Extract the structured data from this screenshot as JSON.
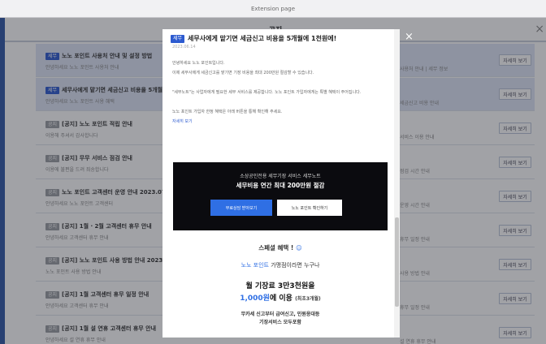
{
  "window": {
    "title": "Extension page"
  },
  "page": {
    "title": "공지",
    "close": "×"
  },
  "rows": [
    {
      "badge": "세무",
      "title": "노노 포인트 사용처 안내 및 설정 방법",
      "snip": "안녕하세요 노노 포인트 사용처 안내",
      "snip_r": "사용처 안내 | 세무 정보",
      "more": "자세히 보기"
    },
    {
      "badge": "세무",
      "title": "세무사에게 맡기면 세금신고 비용을 5개월에 1천원에!",
      "snip": "안녕하세요 노노 포인트 사용 혜택",
      "snip_r": "세금신고 비용 안내",
      "more": "자세히 보기"
    },
    {
      "badge": "공지",
      "title": "[공지] 노노 포인트 적립 안내",
      "snip": "이용해 주셔서 감사합니다",
      "snip_r": "서비스 이용 안내",
      "more": "자세히 보기"
    },
    {
      "badge": "공지",
      "title": "[공지] 무무 서비스 점검 안내",
      "snip": "이용에 불편을 드려 죄송합니다",
      "snip_r": "점검 시간 안내",
      "more": "자세히 보기"
    },
    {
      "badge": "공지",
      "title": "노노 포인트 고객센터 운영 안내 2023.07.31",
      "snip": "안녕하세요 노노 포인트 고객센터",
      "snip_r": "운영 시간 안내",
      "more": "자세히 보기"
    },
    {
      "badge": "공지",
      "title": "[공지] 1월 · 2월 고객센터 휴무 안내",
      "snip": "안녕하세요 고객센터 휴무 안내",
      "snip_r": "휴무 일정 안내",
      "more": "자세히 보기"
    },
    {
      "badge": "공지",
      "title": "[공지] 노노 포인트 사용 방법 안내 2023.02",
      "snip": "노노 포인트 사용 방법 안내",
      "snip_r": "사용 방법 안내",
      "more": "자세히 보기"
    },
    {
      "badge": "공지",
      "title": "[공지] 1월 고객센터 휴무 일정 안내",
      "snip": "안녕하세요 고객센터 휴무 안내",
      "snip_r": "휴무 일정 안내",
      "more": "자세히 보기"
    },
    {
      "badge": "공지",
      "title": "[공지] 1월 설 연휴 고객센터 휴무 안내",
      "snip": "안녕하세요 설 연휴 휴무 안내",
      "snip_r": "설 연휴 휴무 안내",
      "more": "자세히 보기"
    }
  ],
  "modal": {
    "close": "×",
    "badge": "세무",
    "title": "세무사에게 맡기면 세금신고 비용을 5개월에 1천원에!",
    "date": "2023.06.14",
    "paragraphs": [
      "안녕하세요 노노 포인트입니다.",
      "이제 세무사에게 세금신고를 맡기면 기장 비용을 최대 200만원 절감할 수 있습니다.",
      "\"세무노트\"는 사업자에게 필요한 세무 서비스를 제공합니다. 노노 포인트 가입자에게는 특별 혜택이 주어집니다.",
      "노노 포인트 가입자 한정 혜택은 아래 버튼을 통해 확인해 주세요."
    ],
    "link_text": "자세히 보기",
    "banner": {
      "line1": "소상공인전용 세무기장 서비스 세무노트",
      "line2": "세무비용 연간 최대 200만원 절감",
      "btn_a": "무료상담 받아보기",
      "btn_b": "노노 포인트 확인하기"
    },
    "special": {
      "title": "스페셜 혜택 !",
      "line2_a": "노노 포인트",
      "line2_b": " 가맹점이라면 누구나",
      "line3": "월 기장료 3만3천원을",
      "line4_a": "1,000원",
      "line4_b": "에 이용",
      "line4_c": "(최초3개월)",
      "line5": "무카세 신고부터 급여신고, 민원응대등",
      "line6": "기장서비스 모두포함"
    }
  }
}
